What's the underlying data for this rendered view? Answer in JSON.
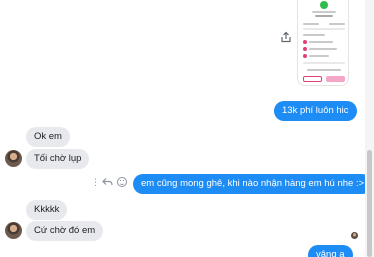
{
  "conversation": {
    "shared_image": {
      "label": "Shared order screenshot"
    },
    "messages": [
      {
        "sender": "me",
        "text": "13k phí luôn hic"
      },
      {
        "sender": "contact",
        "text": "Ok em"
      },
      {
        "sender": "contact",
        "text": "Tối chờ lụp"
      },
      {
        "sender": "me",
        "text": "em cũng mong ghê, khi nào nhận hàng em hú nhe :>"
      },
      {
        "sender": "contact",
        "text": "Kkkkk"
      },
      {
        "sender": "contact",
        "text": "Cứ chờ đó em"
      },
      {
        "sender": "me",
        "text": "vâng ạ"
      }
    ]
  },
  "icons": {
    "share": "share-icon",
    "more": "more-options-icon",
    "reply": "reply-icon",
    "react": "smiley-icon"
  },
  "colors": {
    "outgoing_bubble": "#1e8cf5",
    "incoming_bubble": "#e8e9ec",
    "check_green": "#2fbd4c",
    "accent_pink": "#e0407a"
  }
}
